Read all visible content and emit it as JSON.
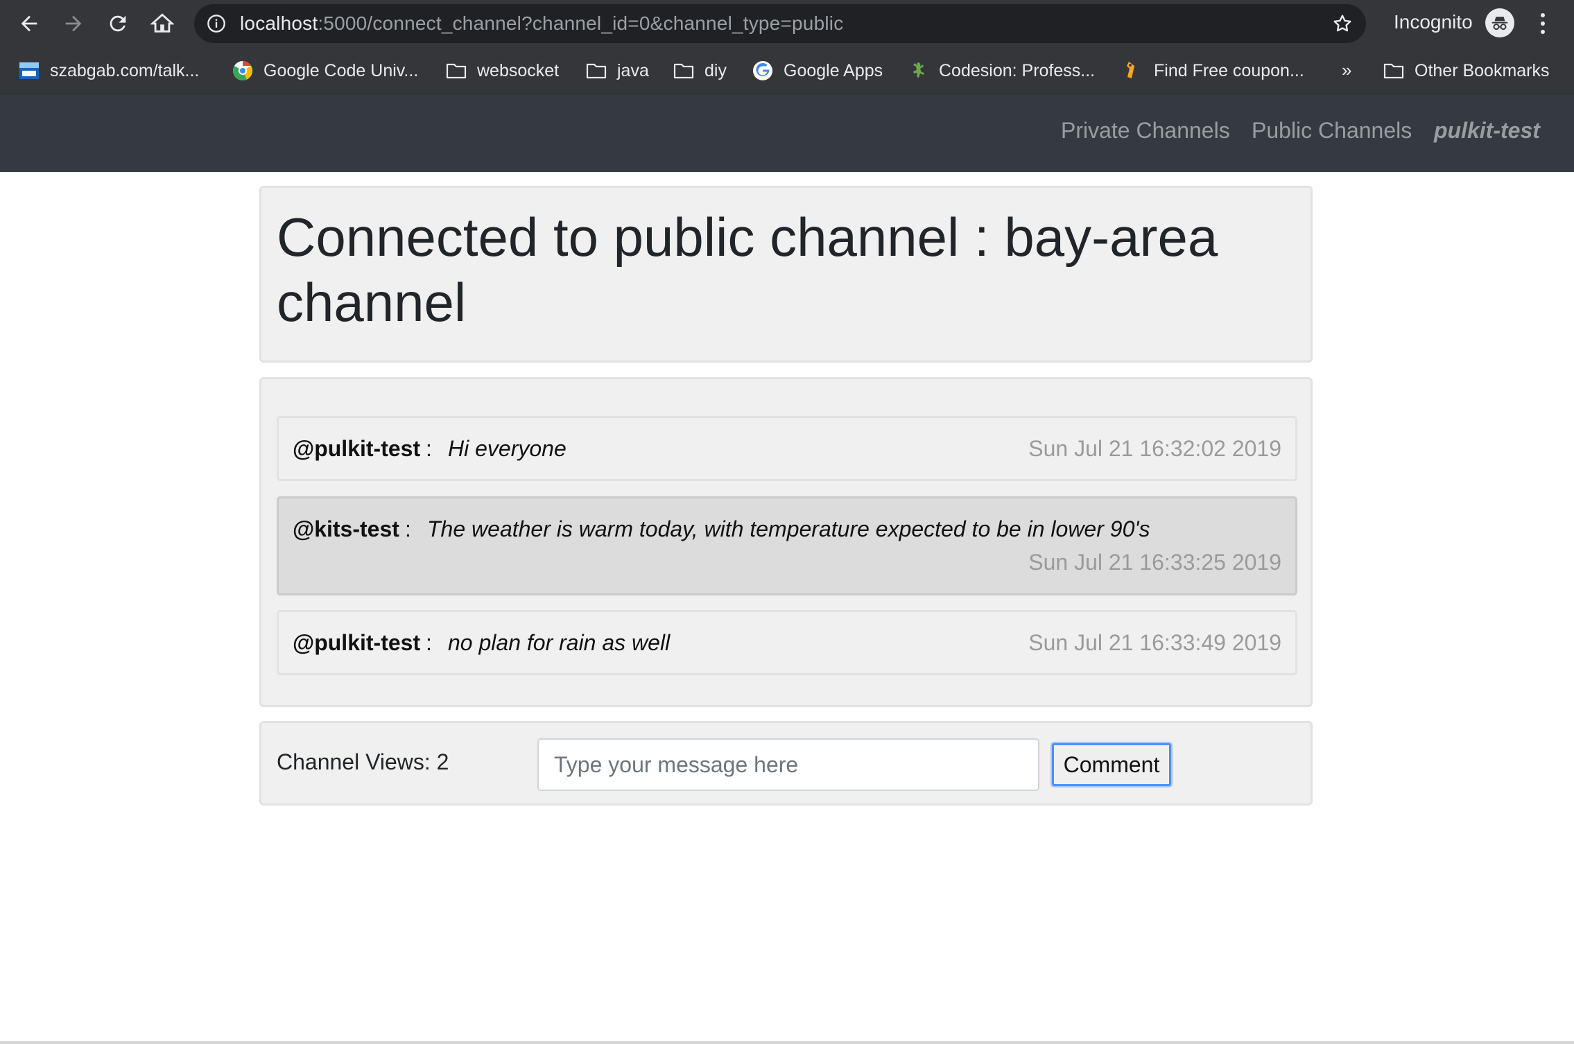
{
  "browser": {
    "url_host": "localhost",
    "url_rest": ":5000/connect_channel?channel_id=0&channel_type=public",
    "incognito_label": "Incognito",
    "bookmarks": [
      {
        "label": "szabgab.com/talk..."
      },
      {
        "label": "Google Code Univ..."
      },
      {
        "label": "websocket"
      },
      {
        "label": "java"
      },
      {
        "label": "diy"
      },
      {
        "label": "Google Apps"
      },
      {
        "label": "Codesion: Profess..."
      },
      {
        "label": "Find Free coupon..."
      }
    ],
    "more_bookmarks": "»",
    "other_bookmarks": "Other Bookmarks"
  },
  "navbar": {
    "private_channels": "Private Channels",
    "public_channels": "Public Channels",
    "user": "pulkit-test"
  },
  "header": {
    "title": "Connected to public channel : bay-area channel"
  },
  "messages": [
    {
      "user": "@pulkit-test",
      "sep": ":",
      "text": "Hi everyone",
      "time": "Sun Jul 21 16:32:02 2019"
    },
    {
      "user": "@kits-test",
      "sep": ":",
      "text": "The weather is warm today, with temperature expected to be in lower 90's",
      "time": "Sun Jul 21 16:33:25 2019"
    },
    {
      "user": "@pulkit-test",
      "sep": ":",
      "text": "no plan for rain as well",
      "time": "Sun Jul 21 16:33:49 2019"
    }
  ],
  "footer": {
    "views": "Channel Views: 2",
    "input_placeholder": "Type your message here",
    "comment_label": "Comment"
  }
}
